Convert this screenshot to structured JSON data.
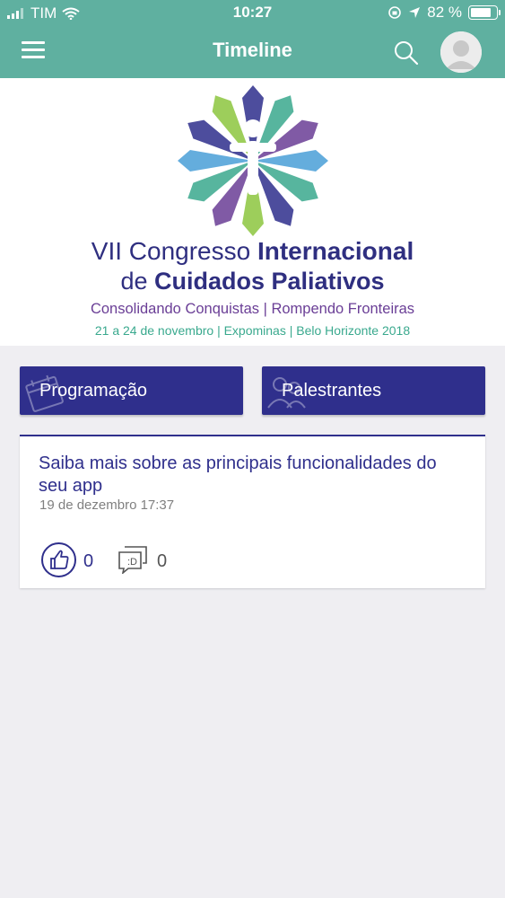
{
  "status_bar": {
    "carrier": "TIM",
    "time": "10:27",
    "battery": "82 %",
    "battery_level": 0.82
  },
  "navbar": {
    "title": "Timeline",
    "menu_icon": "hamburger-menu-icon",
    "search_icon": "search-icon",
    "avatar_icon": "user-avatar-icon"
  },
  "banner": {
    "line1_plain": "VII Congresso ",
    "line1_bold": "Internacional",
    "line2_plain": "de ",
    "line2_bold": "Cuidados Paliativos",
    "tagline": "Consolidando Conquistas | Rompendo Fronteiras",
    "details": "21 a 24 de novembro | Expominas | Belo Horizonte 2018"
  },
  "quick_actions": [
    {
      "label": "Programação",
      "icon": "calendar-icon"
    },
    {
      "label": "Palestrantes",
      "icon": "people-icon"
    }
  ],
  "post": {
    "title": "Saiba mais sobre as principais funcionalidades do seu app",
    "date": "19 de dezembro 17:37",
    "likes": "0",
    "comments": "0",
    "like_icon": "thumbs-up-icon",
    "comment_icon": "comment-icon"
  },
  "colors": {
    "header": "#5fb0a0",
    "primary": "#2f2f8c",
    "background": "#efeef2"
  }
}
